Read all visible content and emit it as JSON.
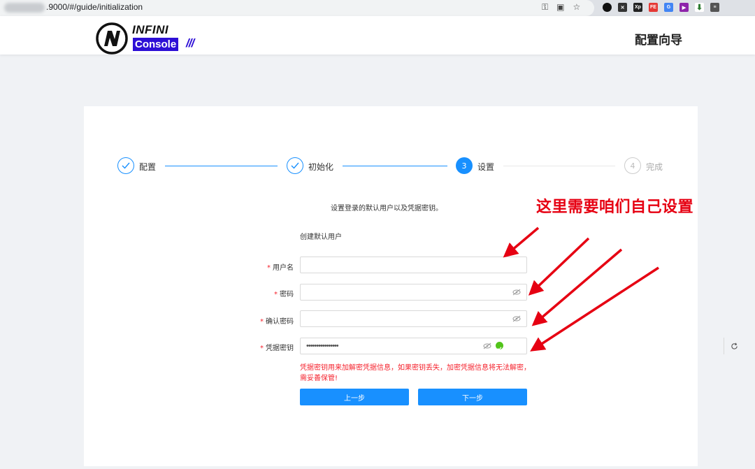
{
  "browser": {
    "url": ".9000/#/guide/initialization"
  },
  "header": {
    "logo_top": "INFINI",
    "logo_bottom": "Console",
    "logo_slashes": "///",
    "title": "配置向导"
  },
  "steps": [
    {
      "number": "1",
      "label": "配置",
      "status": "done"
    },
    {
      "number": "2",
      "label": "初始化",
      "status": "done"
    },
    {
      "number": "3",
      "label": "设置",
      "status": "active"
    },
    {
      "number": "4",
      "label": "完成",
      "status": "wait"
    }
  ],
  "form": {
    "description": "设置登录的默认用户以及凭据密钥。",
    "section_title": "创建默认用户",
    "username": {
      "label": "用户名",
      "value": ""
    },
    "password": {
      "label": "密码",
      "value": ""
    },
    "confirm_password": {
      "label": "确认密码",
      "value": ""
    },
    "credential_secret": {
      "label": "凭据密钥",
      "value": "••••••••••••••••"
    },
    "help_text": "凭据密钥用来加解密凭据信息，如果密钥丢失，加密凭据信息将无法解密，需妥善保管!",
    "prev_button": "上一步",
    "next_button": "下一步"
  },
  "annotation": {
    "text": "这里需要咱们自己设置",
    "color": "#e60012"
  },
  "colors": {
    "primary": "#1890ff",
    "brand": "#2d0fd6",
    "error": "#f5222d",
    "success": "#52c41a"
  }
}
